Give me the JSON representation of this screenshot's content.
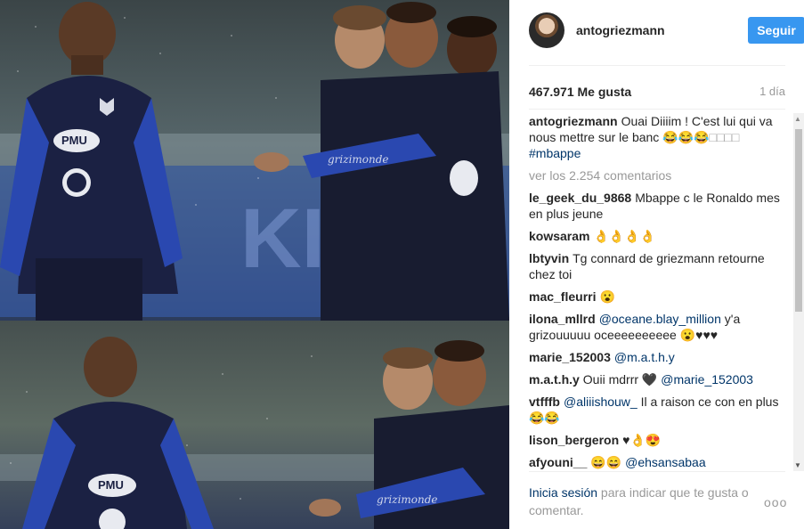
{
  "post": {
    "watermark_top": "grizimonde",
    "watermark_bottom": "grizimonde",
    "sponsor_top": "PMU",
    "sponsor_bottom": "PMU"
  },
  "header": {
    "username": "antogriezmann",
    "follow_label": "Seguir"
  },
  "stats": {
    "likes": "467.971 Me gusta",
    "time": "1 día"
  },
  "caption": {
    "user": "antogriezmann",
    "text": "Ouai Diiiim ! C'est lui qui va nous mettre sur le banc 😂😂😂",
    "boxes": "□□□□",
    "hashtag": "#mbappe"
  },
  "view_all": "ver los 2.254 comentarios",
  "comments": [
    {
      "user": "le_geek_du_9868",
      "pre": "Mbappe c le Ronaldo mes en plus jeune",
      "mention": "",
      "post": ""
    },
    {
      "user": "kowsaram",
      "pre": "👌👌👌👌",
      "mention": "",
      "post": ""
    },
    {
      "user": "lbtyvin",
      "pre": "Tg connard de griezmann retourne chez toi",
      "mention": "",
      "post": ""
    },
    {
      "user": "mac_fleurri",
      "pre": "😮",
      "mention": "",
      "post": ""
    },
    {
      "user": "ilona_mllrd",
      "pre": "",
      "mention": "@oceane.blay_million",
      "post": " y'a grizouuuuu oceeeeeeeeee 😮♥♥♥"
    },
    {
      "user": "marie_152003",
      "pre": "",
      "mention": "@m.a.t.h.y",
      "post": ""
    },
    {
      "user": "m.a.t.h.y",
      "pre": "Ouii mdrrr 🖤 ",
      "mention": "@marie_152003",
      "post": ""
    },
    {
      "user": "vtfffb",
      "pre": "",
      "mention": "@aliiishouw_",
      "post": " Il a raison ce con en plus 😂😂"
    },
    {
      "user": "lison_bergeron",
      "pre": "♥👌😍",
      "mention": "",
      "post": ""
    },
    {
      "user": "afyouni__",
      "pre": "😄😄 ",
      "mention": "@ehsansabaa",
      "post": ""
    }
  ],
  "footer": {
    "login_link": "Inicia sesión",
    "rest": " para indicar que te gusta o comentar.",
    "more": "ooo"
  },
  "icons": {
    "more": "more-options-icon",
    "scroll_up": "arrow-up-icon",
    "scroll_down": "arrow-down-icon"
  },
  "colors": {
    "accent": "#3897f0",
    "link": "#003569",
    "muted": "#999999",
    "jersey": "#1c2850",
    "sleeve": "#2a48b0"
  }
}
